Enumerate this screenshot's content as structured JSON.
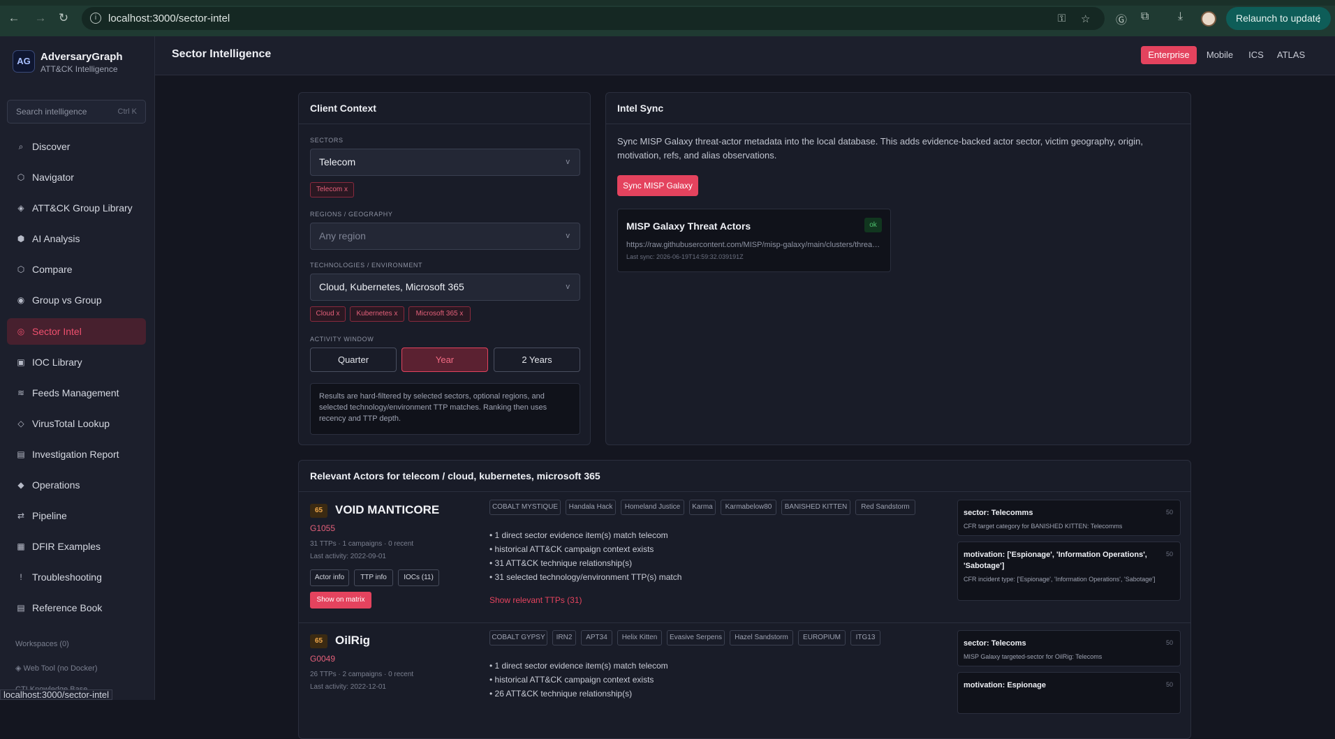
{
  "browser": {
    "url": "localhost:3000/sector-intel",
    "relaunch_label": "Relaunch to update",
    "status_url": "localhost:3000/sector-intel"
  },
  "brand": {
    "logo": "AG",
    "name": "AdversaryGraph",
    "subtitle": "ATT&CK Intelligence"
  },
  "search": {
    "placeholder": "Search intelligence",
    "shortcut": "Ctrl K"
  },
  "sidebar": {
    "items": [
      {
        "label": "Discover",
        "icon": "⌕"
      },
      {
        "label": "Navigator",
        "icon": "⬡"
      },
      {
        "label": "ATT&CK Group Library",
        "icon": "◈"
      },
      {
        "label": "AI Analysis",
        "icon": "⬢"
      },
      {
        "label": "Compare",
        "icon": "⬡"
      },
      {
        "label": "Group vs Group",
        "icon": "◉"
      },
      {
        "label": "Sector Intel",
        "icon": "◎"
      },
      {
        "label": "IOC Library",
        "icon": "▣"
      },
      {
        "label": "Feeds Management",
        "icon": "≋"
      },
      {
        "label": "VirusTotal Lookup",
        "icon": "◇"
      },
      {
        "label": "Investigation Report",
        "icon": "▤"
      },
      {
        "label": "Operations",
        "icon": "◆"
      },
      {
        "label": "Pipeline",
        "icon": "⇄"
      },
      {
        "label": "DFIR Examples",
        "icon": "▦"
      },
      {
        "label": "Troubleshooting",
        "icon": "!"
      },
      {
        "label": "Reference Book",
        "icon": "▤"
      }
    ],
    "workspaces": "Workspaces (0)",
    "web_tool": "◈ Web Tool (no Docker)",
    "cti_kb": "CTI Knowledge Base"
  },
  "header": {
    "title": "Sector Intelligence",
    "matrices": [
      "Enterprise",
      "Mobile",
      "ICS",
      "ATLAS"
    ]
  },
  "client_context": {
    "title": "Client Context",
    "sectors_label": "SECTORS",
    "sectors_value": "Telecom",
    "sector_chips": [
      "Telecom x"
    ],
    "regions_label": "REGIONS / GEOGRAPHY",
    "regions_placeholder": "Any region",
    "tech_label": "TECHNOLOGIES / ENVIRONMENT",
    "tech_value": "Cloud, Kubernetes, Microsoft 365",
    "tech_chips": [
      "Cloud x",
      "Kubernetes x",
      "Microsoft 365 x"
    ],
    "window_label": "ACTIVITY WINDOW",
    "windows": [
      "Quarter",
      "Year",
      "2 Years"
    ],
    "note": "Results are hard-filtered by selected sectors, optional regions, and selected technology/environment TTP matches. Ranking then uses recency and TTP depth."
  },
  "intel_sync": {
    "title": "Intel Sync",
    "description": "Sync MISP Galaxy threat-actor metadata into the local database. This adds evidence-backed actor sector, victim geography, origin, motivation, refs, and alias observations.",
    "button": "Sync MISP Galaxy",
    "card": {
      "title": "MISP Galaxy Threat Actors",
      "status": "ok",
      "url": "https://raw.githubusercontent.com/MISP/misp-galaxy/main/clusters/threat-actor.json",
      "last_sync": "Last sync: 2026-06-19T14:59:32.039191Z"
    }
  },
  "actors": {
    "title": "Relevant Actors for telecom / cloud, kubernetes, microsoft 365",
    "list": [
      {
        "score": "65",
        "name": "VOID MANTICORE",
        "id": "G1055",
        "meta": "31 TTPs · 1 campaigns · 0 recent",
        "last": "Last activity: 2022-09-01",
        "buttons": [
          "Actor info",
          "TTP info",
          "IOCs (11)"
        ],
        "matrix": "Show on matrix",
        "aliases": [
          "COBALT MYSTIQUE",
          "Handala Hack",
          "Homeland Justice",
          "Karma",
          "Karmabelow80",
          "BANISHED KITTEN",
          "Red Sandstorm"
        ],
        "bullets": [
          "• 1 direct sector evidence item(s) match telecom",
          "• historical ATT&CK campaign context exists",
          "• 31 ATT&CK technique relationship(s)",
          "• 31 selected technology/environment TTP(s) match"
        ],
        "show_ttps": "Show relevant TTPs (31)",
        "evidence": [
          {
            "title": "sector: Telecomms",
            "score": "50",
            "detail": "CFR target category for BANISHED KITTEN: Telecomms"
          },
          {
            "title": "motivation: ['Espionage', 'Information Operations', 'Sabotage']",
            "score": "50",
            "detail": "CFR incident type: ['Espionage', 'Information Operations', 'Sabotage']"
          }
        ]
      },
      {
        "score": "65",
        "name": "OilRig",
        "id": "G0049",
        "meta": "26 TTPs · 2 campaigns · 0 recent",
        "last": "Last activity: 2022-12-01",
        "aliases": [
          "COBALT GYPSY",
          "IRN2",
          "APT34",
          "Helix Kitten",
          "Evasive Serpens",
          "Hazel Sandstorm",
          "EUROPIUM",
          "ITG13"
        ],
        "bullets": [
          "• 1 direct sector evidence item(s) match telecom",
          "• historical ATT&CK campaign context exists",
          "• 26 ATT&CK technique relationship(s)"
        ],
        "evidence": [
          {
            "title": "sector: Telecoms",
            "score": "50",
            "detail": "MISP Galaxy targeted-sector for OilRig: Telecoms"
          },
          {
            "title": "motivation: Espionage",
            "score": "50",
            "detail": ""
          }
        ]
      }
    ]
  },
  "colors": {
    "accent": "#e4435e",
    "background": "#141620",
    "panel": "#191c28"
  }
}
